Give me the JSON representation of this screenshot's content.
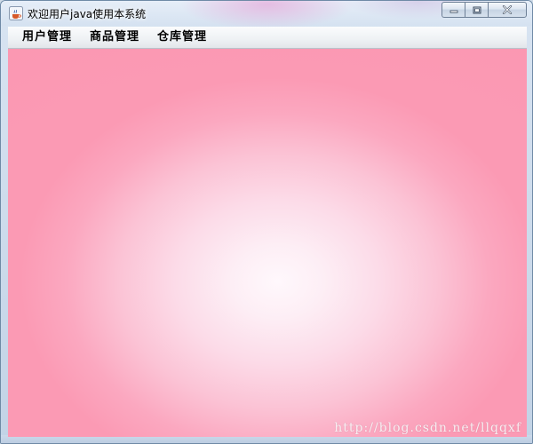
{
  "window": {
    "title": "欢迎用户java使用本系统",
    "app_icon": "java-cup-icon",
    "controls": {
      "minimize_icon": "minimize-icon",
      "maximize_icon": "maximize-icon",
      "close_icon": "close-icon"
    }
  },
  "menubar": {
    "items": [
      {
        "label": "用户管理"
      },
      {
        "label": "商品管理"
      },
      {
        "label": "仓库管理"
      }
    ]
  },
  "content": {
    "gradient_center_color": "#fff8fc",
    "gradient_edge_color": "#fb9ab4",
    "watermark": "http://blog.csdn.net/llqqxf"
  }
}
